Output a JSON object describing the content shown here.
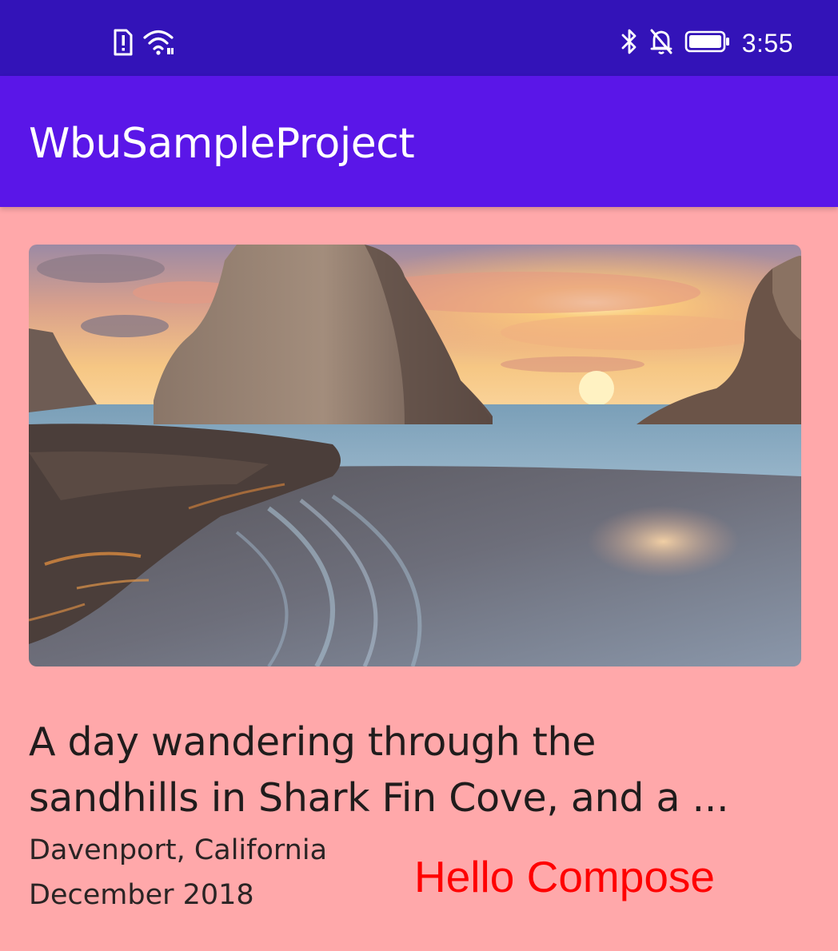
{
  "status_bar": {
    "time": "3:55",
    "icons": [
      "alert-icon",
      "wifi-icon",
      "bluetooth-icon",
      "notifications-off-icon",
      "battery-icon"
    ],
    "background": "#3313b8"
  },
  "app_bar": {
    "title": "WbuSampleProject",
    "background": "#5a16e8"
  },
  "card": {
    "image_alt": "Sunset over Shark Fin Cove rock formation and beach",
    "headline_lines": [
      "A day wandering through the",
      "sandhills in Shark Fin Cove, and a ..."
    ],
    "location": "Davenport, California",
    "date": "December 2018",
    "background": "#ffa8aa"
  },
  "greeting": {
    "text": "Hello Compose",
    "color": "#ff0000"
  }
}
